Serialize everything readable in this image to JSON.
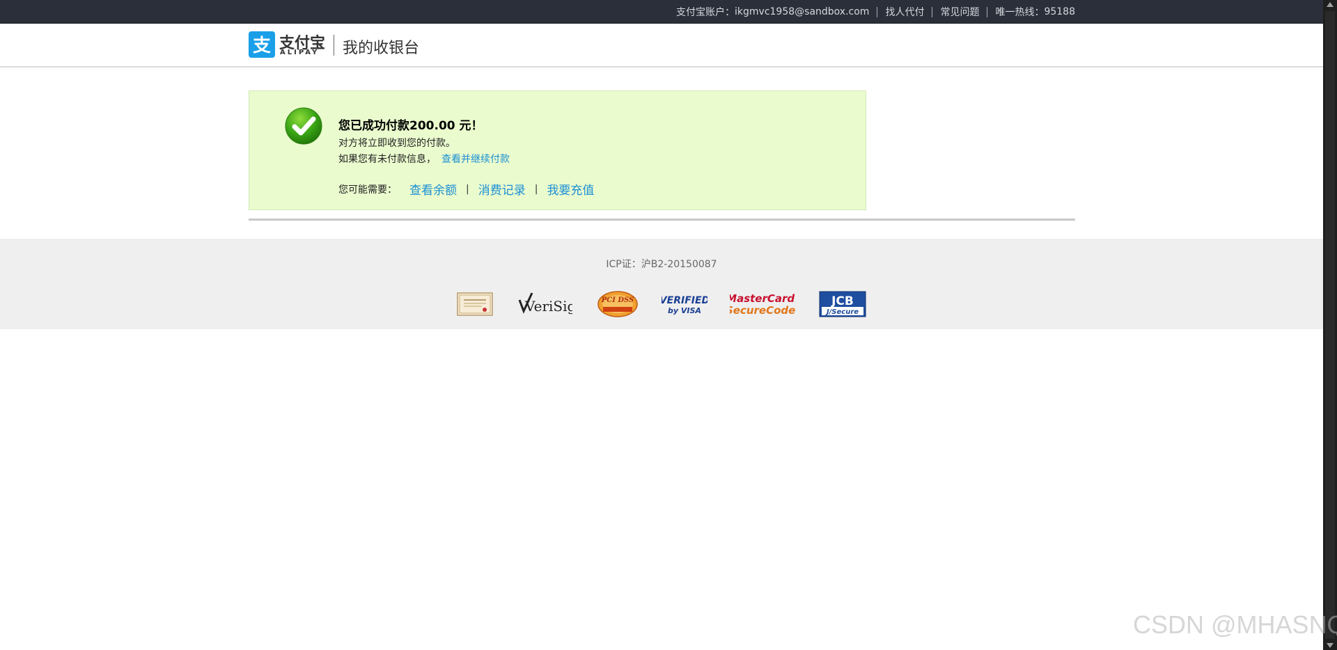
{
  "topbar": {
    "account_label": "支付宝账户：",
    "account_value": "ikgmvc1958@sandbox.com",
    "link_find_agent": "找人代付",
    "link_faq": "常见问题",
    "hotline_label": "唯一热线：",
    "hotline_number": "95188"
  },
  "header": {
    "logo_cn": "支付宝",
    "logo_en": "ALIPAY",
    "page_title": "我的收银台",
    "brand_color": "#1a9fe8"
  },
  "result": {
    "title": "您已成功付款200.00 元！",
    "line1": "对方将立即收到您的付款。",
    "line2_text": "如果您有未付款信息，",
    "line2_link": "查看并继续付款",
    "need_label": "您可能需要：",
    "links": [
      "查看余额",
      "消费记录",
      "我要充值"
    ],
    "separator": "|",
    "box_color": "#eafbce",
    "link_color": "#1c90d4",
    "icon": "check-circle-icon"
  },
  "footer": {
    "icp": "ICP证：沪B2-20150087",
    "badges": [
      {
        "name": "certificate-badge",
        "text": ""
      },
      {
        "name": "verisign-badge",
        "text": "VeriSign"
      },
      {
        "name": "pcl-dss-badge",
        "text": "PCI DSS"
      },
      {
        "name": "verified-by-visa-badge",
        "text": "VERIFIED by VISA"
      },
      {
        "name": "mastercard-securecode-badge",
        "text": "MasterCard. SecureCode."
      },
      {
        "name": "jcb-jsecure-badge",
        "text": "JCB J/Secure"
      }
    ]
  },
  "watermark": "CSDN @MHASNQ"
}
